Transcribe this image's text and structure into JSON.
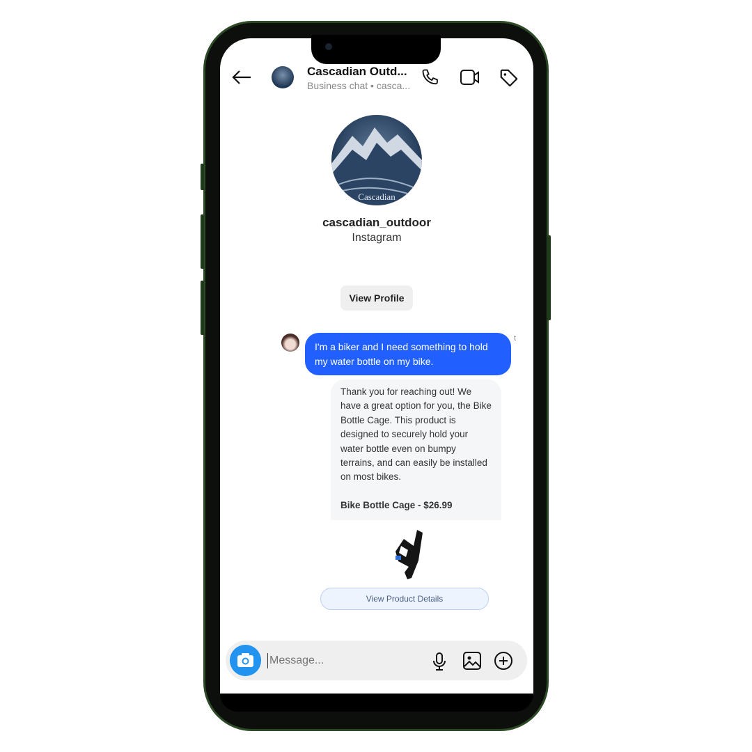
{
  "header": {
    "title": "Cascadian Outd...",
    "subtitle": "Business chat • casca...",
    "icons": [
      "back-arrow-icon",
      "phone-icon",
      "video-icon",
      "tag-icon"
    ]
  },
  "profile": {
    "logo_text": "Cascadian",
    "username": "cascadian_outdoor",
    "platform": "Instagram",
    "view_profile_label": "View Profile"
  },
  "messages": [
    {
      "from": "user",
      "text": "I'm a biker and I need something to hold my water bottle on my bike.",
      "side_mark": "t"
    },
    {
      "from": "business",
      "text": "Thank you for reaching out! We have a great option for you, the Bike Bottle Cage. This product is designed to securely hold your water bottle even on bumpy terrains, and can easily be installed on most bikes.",
      "product": "Bike Bottle Cage - $26.99",
      "cta": "View Product Details"
    }
  ],
  "composer": {
    "placeholder": "Message...",
    "icons": [
      "camera-icon",
      "microphone-icon",
      "image-icon",
      "plus-icon"
    ]
  },
  "colors": {
    "accent": "#2160ff",
    "frame": "#2d4a26"
  }
}
